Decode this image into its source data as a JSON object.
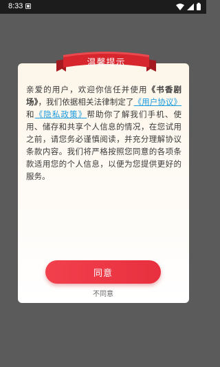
{
  "status_bar": {
    "time": "8:33"
  },
  "dialog": {
    "title": "温馨提示",
    "body": {
      "p1": "亲爱的用户，欢迎你信任并使用",
      "app_name": "《书香剧场》",
      "p2": "，我们依据相关法律制定了",
      "user_agreement": "《用户协议》",
      "p3": "和",
      "privacy_policy": "《隐私政策》",
      "p4": "帮助你了解我们手机、使用、储存和共享个人信息的情况，在您试用之前，请您务必谨慎阅读，并充分理解协议条款内容。我们将严格按照您同意的各项条款适用您的个人信息，以便为您提供更好的服务。"
    },
    "agree_label": "同意",
    "disagree_label": "不同意"
  },
  "colors": {
    "accent": "#e8303f",
    "link": "#1a9be0",
    "ribbon": "#d7262e"
  },
  "icons": [
    "notification-icon",
    "wifi-icon",
    "signal-icon",
    "battery-icon"
  ]
}
